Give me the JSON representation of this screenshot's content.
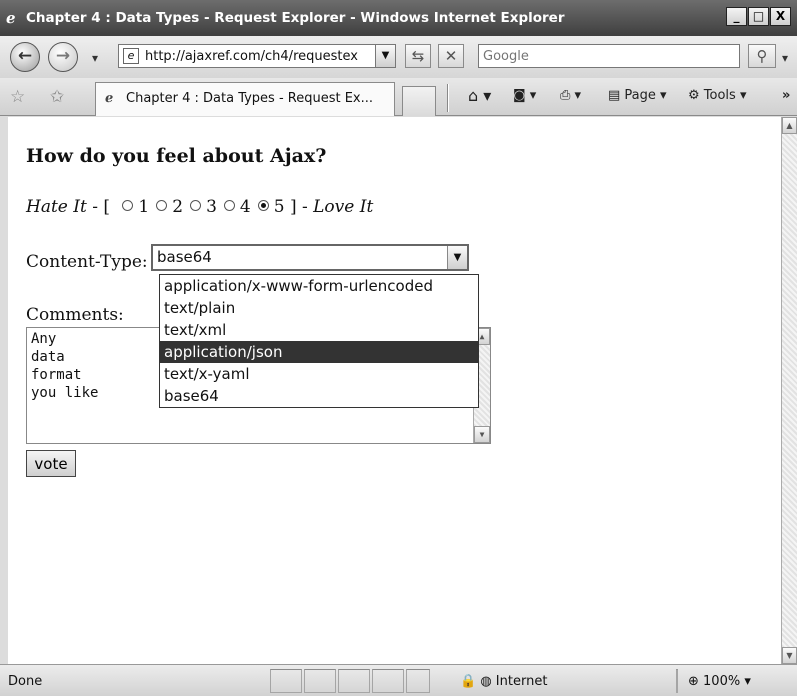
{
  "window": {
    "title": "Chapter 4 : Data Types - Request Explorer - Windows Internet Explorer",
    "minimize": "_",
    "maximize": "□",
    "close": "X"
  },
  "address_bar": {
    "url": "http://ajaxref.com/ch4/requestex",
    "search_placeholder": "Google"
  },
  "tab": {
    "label": "Chapter 4 : Data Types - Request Ex..."
  },
  "command_bar": {
    "page": "Page",
    "tools": "Tools"
  },
  "form": {
    "heading": "How do you feel about Ajax?",
    "hate_label": "Hate It",
    "love_label": "Love It",
    "rating_options": [
      "1",
      "2",
      "3",
      "4",
      "5"
    ],
    "rating_selected": "5",
    "content_type_label": "Content-Type:",
    "content_type_value": "base64",
    "content_type_options": [
      "application/x-www-form-urlencoded",
      "text/plain",
      "text/xml",
      "application/json",
      "text/x-yaml",
      "base64"
    ],
    "highlighted_option": "application/json",
    "comments_label": "Comments:",
    "comments_lines": [
      "Any",
      "data",
      "format",
      "you like"
    ],
    "vote_label": "vote"
  },
  "status_bar": {
    "status": "Done",
    "zone": "Internet",
    "zoom": "100%"
  }
}
